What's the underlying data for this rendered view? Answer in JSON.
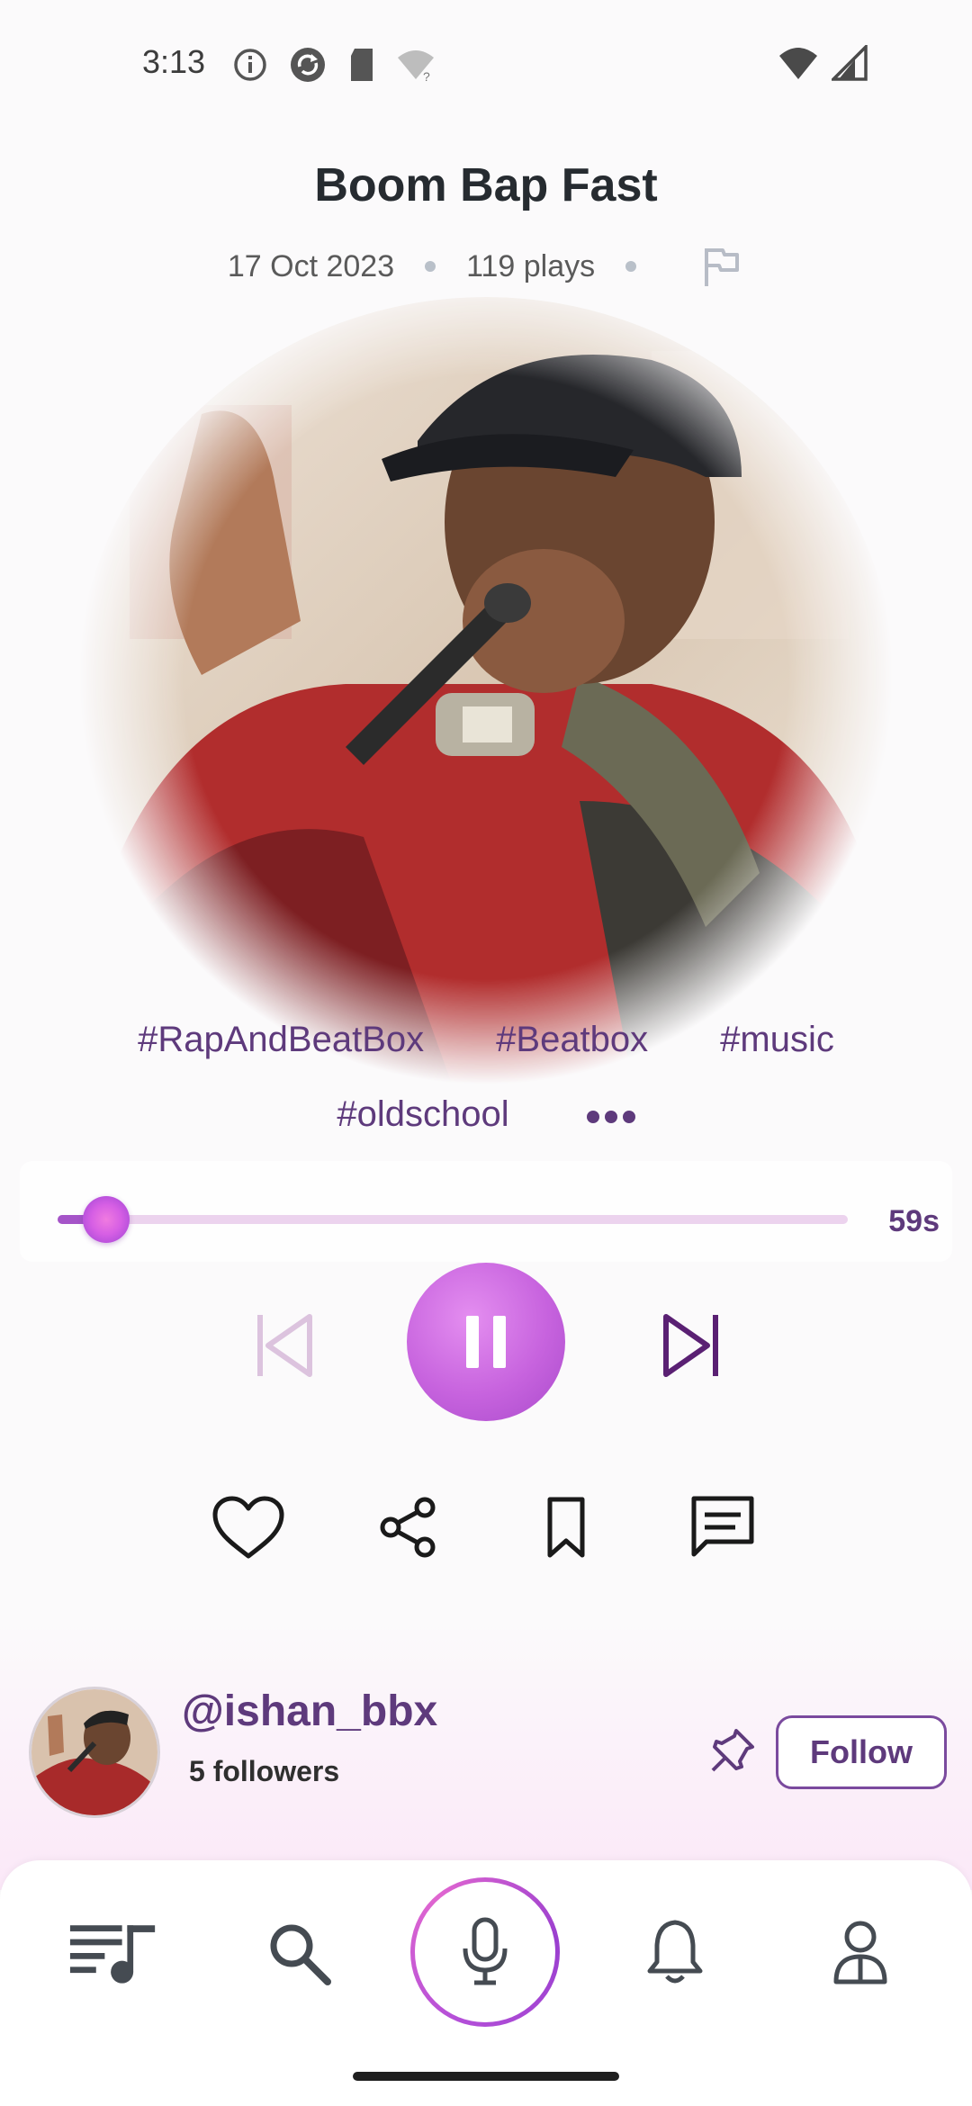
{
  "status_bar": {
    "time": "3:13",
    "left_icons": [
      "info-icon",
      "sync-icon",
      "sd-card-icon",
      "wifi-question-icon"
    ],
    "right_icons": [
      "wifi-icon",
      "signal-icon"
    ]
  },
  "track": {
    "title": "Boom Bap Fast",
    "date": "17 Oct 2023",
    "plays": "119 plays"
  },
  "tags": {
    "row1": [
      "#RapAndBeatBox",
      "#Beatbox",
      "#music"
    ],
    "row2": [
      "#oldschool"
    ]
  },
  "player": {
    "progress_fraction": 0.05,
    "time_label": "59s",
    "state": "playing"
  },
  "artist": {
    "handle": "@ishan_bbx",
    "followers": "5 followers",
    "follow_label": "Follow"
  },
  "nav": {
    "items": [
      "playlist-icon",
      "search-icon",
      "mic-icon",
      "bell-icon",
      "profile-icon"
    ]
  },
  "colors": {
    "accent": "#5e3a7c",
    "play_button": "#c763de",
    "progress_track": "#ecd3ee"
  }
}
